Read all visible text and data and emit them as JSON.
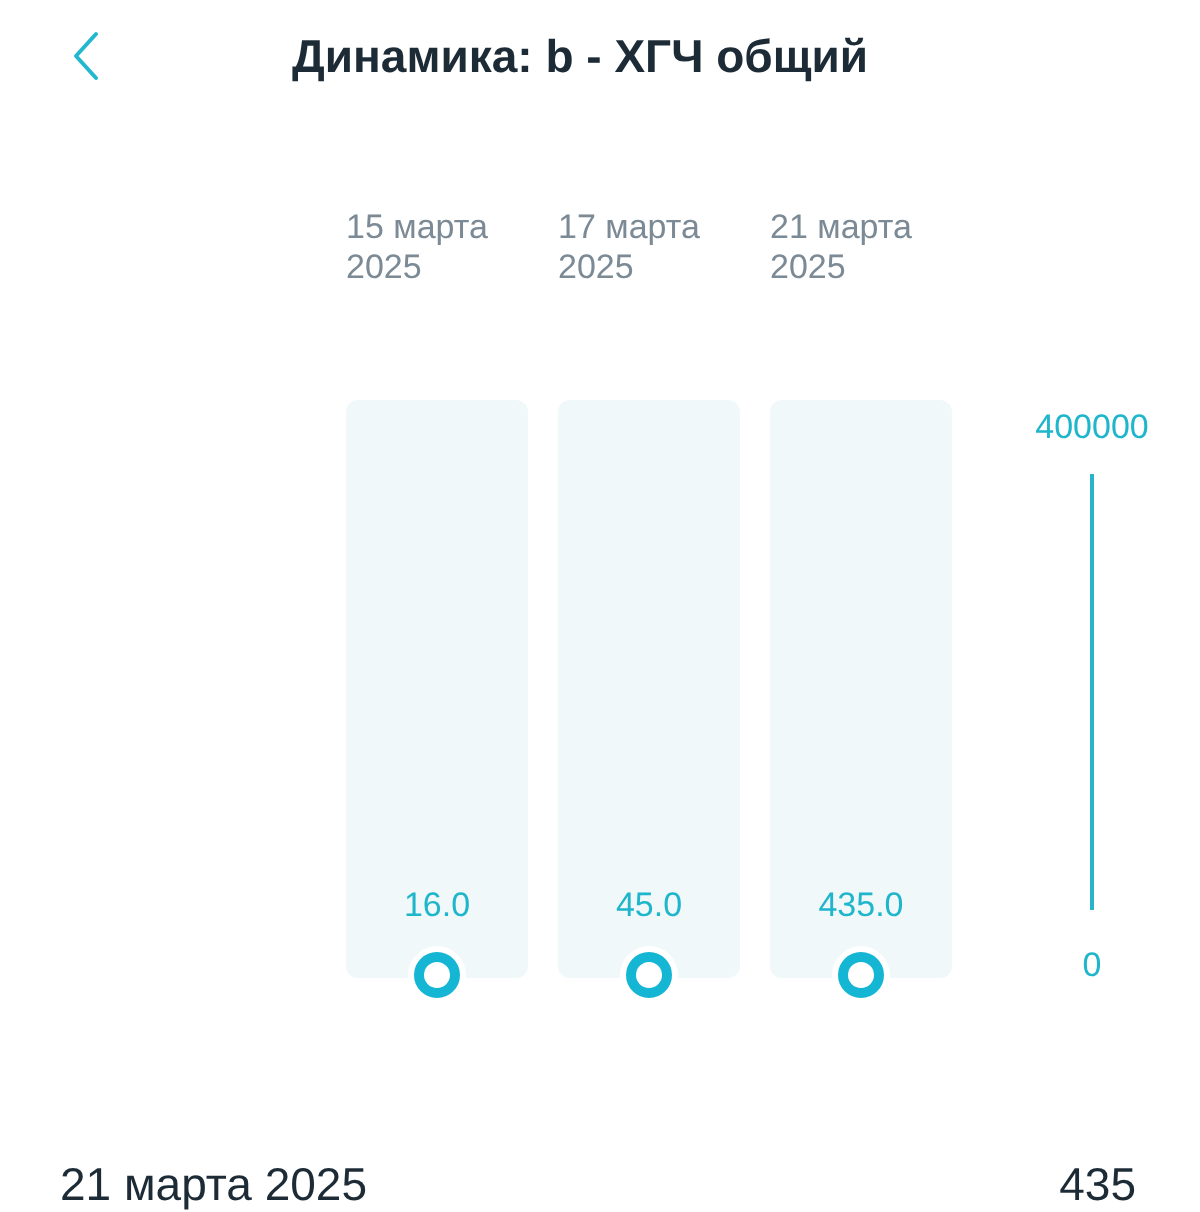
{
  "header": {
    "title": "Динамика: b - ХГЧ общий"
  },
  "columns": [
    {
      "date": "15 марта 2025",
      "value": "16.0"
    },
    {
      "date": "17 марта 2025",
      "value": "45.0"
    },
    {
      "date": "21 марта 2025",
      "value": "435.0"
    }
  ],
  "scale": {
    "max": "400000",
    "min": "0"
  },
  "latest": {
    "date": "21 марта 2025",
    "value": "435"
  }
}
